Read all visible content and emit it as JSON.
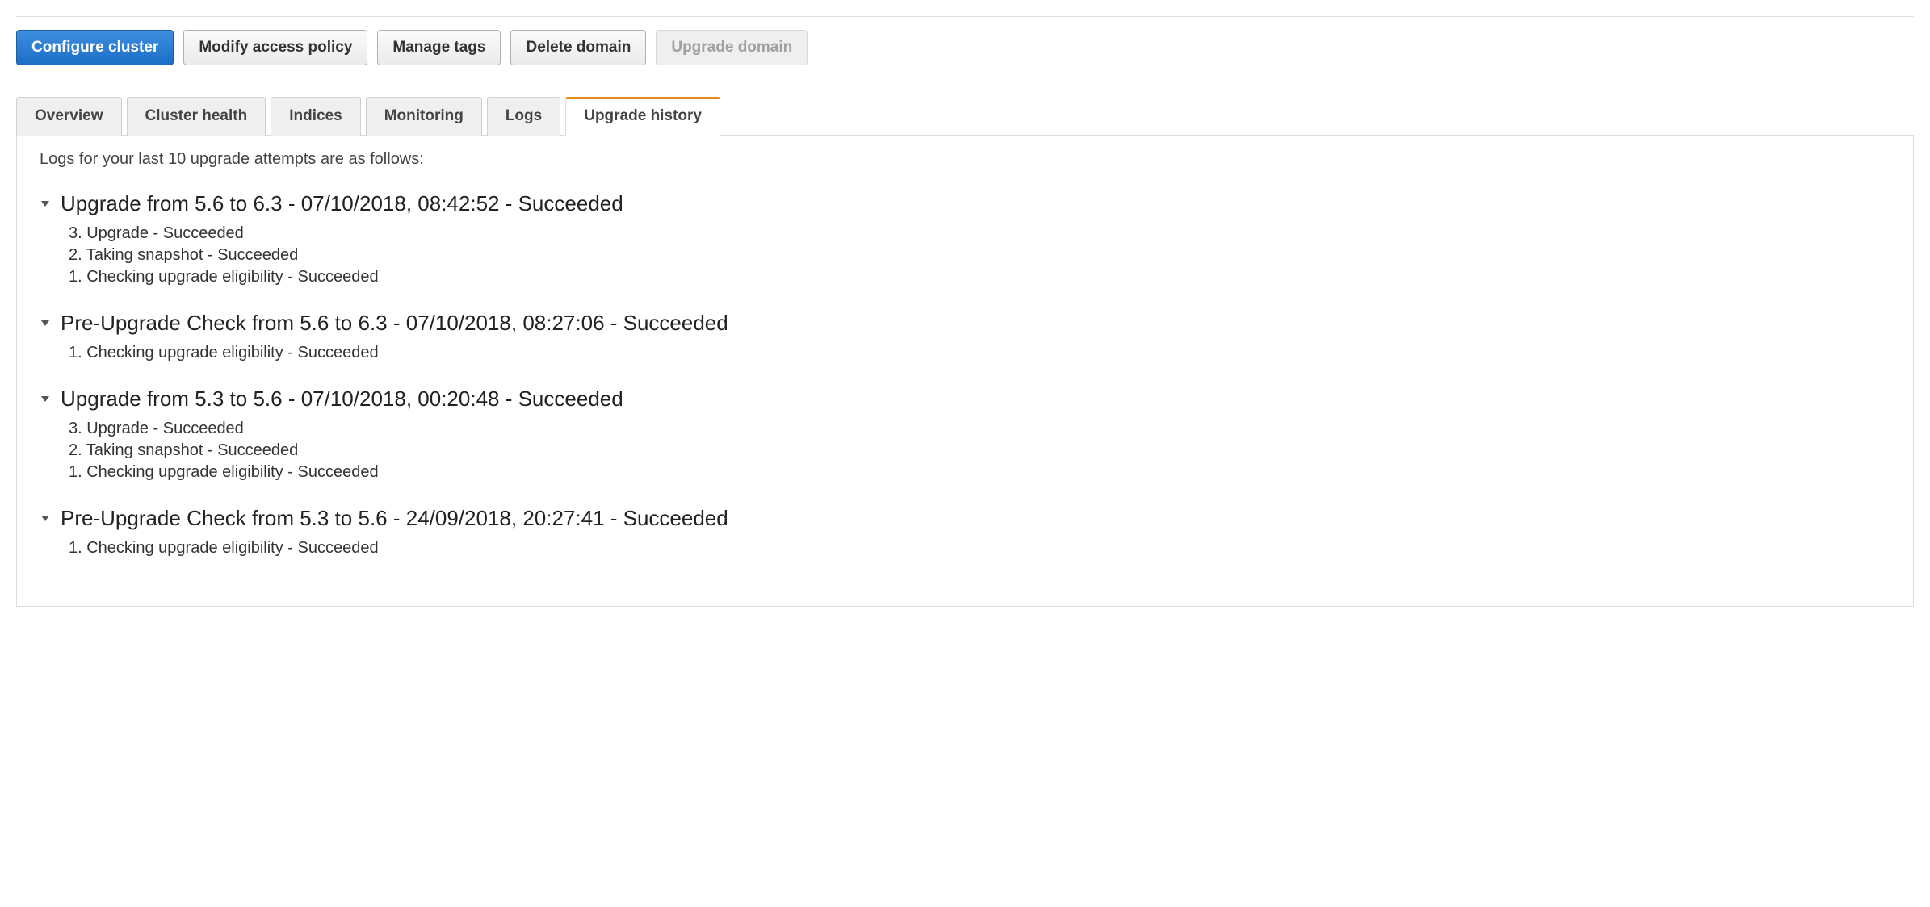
{
  "buttons": {
    "configure": "Configure cluster",
    "modify_policy": "Modify access policy",
    "manage_tags": "Manage tags",
    "delete_domain": "Delete domain",
    "upgrade_domain": "Upgrade domain"
  },
  "tabs": {
    "overview": "Overview",
    "cluster_health": "Cluster health",
    "indices": "Indices",
    "monitoring": "Monitoring",
    "logs": "Logs",
    "upgrade_history": "Upgrade history"
  },
  "intro_text": "Logs for your last 10 upgrade attempts are as follows:",
  "attempts": [
    {
      "title": "Upgrade from 5.6 to 6.3 - 07/10/2018, 08:42:52 - Succeeded",
      "steps": [
        "3. Upgrade - Succeeded",
        "2. Taking snapshot - Succeeded",
        "1. Checking upgrade eligibility - Succeeded"
      ]
    },
    {
      "title": "Pre-Upgrade Check from 5.6 to 6.3 - 07/10/2018, 08:27:06 - Succeeded",
      "steps": [
        "1. Checking upgrade eligibility - Succeeded"
      ]
    },
    {
      "title": "Upgrade from 5.3 to 5.6 - 07/10/2018, 00:20:48 - Succeeded",
      "steps": [
        "3. Upgrade - Succeeded",
        "2. Taking snapshot - Succeeded",
        "1. Checking upgrade eligibility - Succeeded"
      ]
    },
    {
      "title": "Pre-Upgrade Check from 5.3 to 5.6 - 24/09/2018, 20:27:41 - Succeeded",
      "steps": [
        "1. Checking upgrade eligibility - Succeeded"
      ]
    }
  ]
}
